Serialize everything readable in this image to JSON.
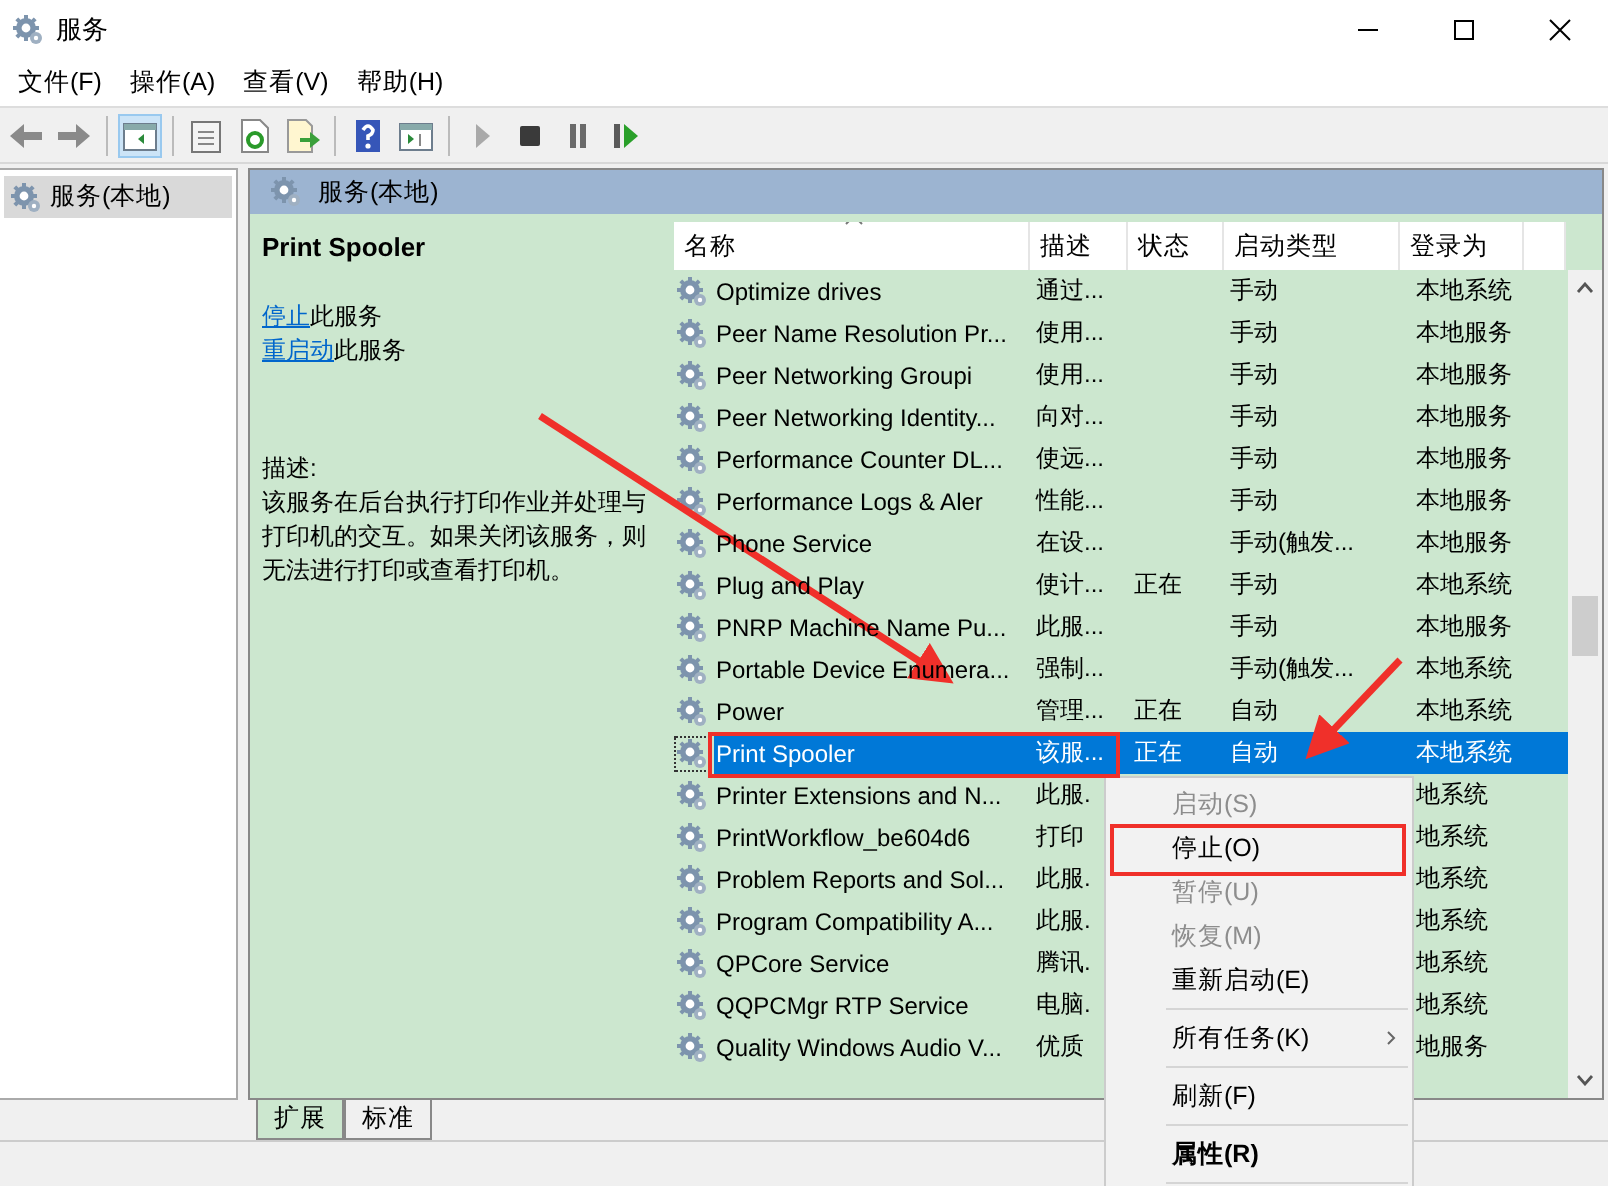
{
  "window": {
    "title": "服务"
  },
  "menu": [
    "文件(F)",
    "操作(A)",
    "查看(V)",
    "帮助(H)"
  ],
  "toolbar": [
    {
      "kind": "back",
      "disabled": false,
      "selected": false
    },
    {
      "kind": "forward",
      "disabled": false,
      "selected": false
    },
    {
      "kind": "separator"
    },
    {
      "kind": "tree",
      "disabled": false,
      "selected": true
    },
    {
      "kind": "separator"
    },
    {
      "kind": "properties",
      "disabled": false,
      "selected": false
    },
    {
      "kind": "refresh",
      "disabled": false,
      "selected": false
    },
    {
      "kind": "export",
      "disabled": false,
      "selected": false
    },
    {
      "kind": "separator"
    },
    {
      "kind": "help",
      "disabled": false,
      "selected": false
    },
    {
      "kind": "pane",
      "disabled": false,
      "selected": false
    },
    {
      "kind": "separator"
    },
    {
      "kind": "play",
      "disabled": true,
      "selected": false
    },
    {
      "kind": "stop",
      "disabled": false,
      "selected": false
    },
    {
      "kind": "pause",
      "disabled": false,
      "selected": false
    },
    {
      "kind": "resume",
      "disabled": false,
      "selected": false
    }
  ],
  "tree": {
    "items": [
      {
        "label": "服务(本地)",
        "selected": true
      }
    ]
  },
  "pane": {
    "title": "服务(本地)"
  },
  "details": {
    "title": "Print Spooler",
    "actions": [
      {
        "link": "停止",
        "text": "此服务"
      },
      {
        "link": "重启动",
        "text": "此服务"
      }
    ],
    "description_label": "描述:",
    "description": "该服务在后台执行打印作业并处理与打印机的交互。如果关闭该服务，则无法进行打印或查看打印机。"
  },
  "table": {
    "columns": [
      "名称",
      "描述",
      "状态",
      "启动类型",
      "登录为"
    ],
    "rows": [
      {
        "name": "Optimize drives",
        "desc": "通过...",
        "startup": "手动",
        "login": "本地系统",
        "selected": false
      },
      {
        "name": "Peer Name Resolution Pr...",
        "desc": "使用...",
        "startup": "手动",
        "login": "本地服务",
        "selected": false
      },
      {
        "name": "Peer Networking Groupi",
        "desc": "使用...",
        "startup": "手动",
        "login": "本地服务",
        "selected": false
      },
      {
        "name": "Peer Networking Identity...",
        "desc": "向对...",
        "startup": "手动",
        "login": "本地服务",
        "selected": false
      },
      {
        "name": "Performance Counter DL...",
        "desc": "使远...",
        "startup": "手动",
        "login": "本地服务",
        "selected": false
      },
      {
        "name": "Performance Logs & Aler",
        "desc": "性能...",
        "startup": "手动",
        "login": "本地服务",
        "selected": false
      },
      {
        "name": "Phone Service",
        "desc": "在设...",
        "startup": "手动(触发...",
        "login": "本地服务",
        "selected": false
      },
      {
        "name": "Plug and Play",
        "desc": "使计...",
        "status": "正在",
        "startup": "手动",
        "login": "本地系统",
        "selected": false
      },
      {
        "name": "PNRP Machine Name Pu...",
        "desc": "此服...",
        "startup": "手动",
        "login": "本地服务",
        "selected": false
      },
      {
        "name": "Portable Device Enumera...",
        "desc": "强制...",
        "startup": "手动(触发...",
        "login": "本地系统",
        "selected": false
      },
      {
        "name": "Power",
        "desc": "管理...",
        "status": "正在",
        "startup": "自动",
        "login": "本地系统",
        "selected": false
      },
      {
        "name": "Print Spooler",
        "desc": "该服...",
        "status": "正在",
        "startup": "自动",
        "login": "本地系统",
        "selected": true
      },
      {
        "name": "Printer Extensions and N...",
        "desc": "此服.",
        "login": "地系统",
        "selected": false
      },
      {
        "name": "PrintWorkflow_be604d6",
        "desc": "打印",
        "login": "地系统",
        "selected": false
      },
      {
        "name": "Problem Reports and Sol...",
        "desc": "此服.",
        "login": "地系统",
        "selected": false
      },
      {
        "name": "Program Compatibility A...",
        "desc": "此服.",
        "login": "地系统",
        "selected": false
      },
      {
        "name": "QPCore Service",
        "desc": "腾讯.",
        "login": "地系统",
        "selected": false
      },
      {
        "name": "QQPCMgr RTP Service",
        "desc": "电脑.",
        "login": "地系统",
        "selected": false
      },
      {
        "name": "Quality Windows Audio V...",
        "desc": "优质",
        "login": "地服务",
        "selected": false
      }
    ]
  },
  "context_menu": [
    {
      "kind": "item",
      "label": "启动(S)",
      "disabled": true,
      "default": false,
      "submenu": false
    },
    {
      "kind": "item",
      "label": "停止(O)",
      "disabled": false,
      "default": false,
      "submenu": false
    },
    {
      "kind": "item",
      "label": "暂停(U)",
      "disabled": true,
      "default": false,
      "submenu": false
    },
    {
      "kind": "item",
      "label": "恢复(M)",
      "disabled": true,
      "default": false,
      "submenu": false
    },
    {
      "kind": "item",
      "label": "重新启动(E)",
      "disabled": false,
      "default": false,
      "submenu": false
    },
    {
      "kind": "separator"
    },
    {
      "kind": "item",
      "label": "所有任务(K)",
      "disabled": false,
      "default": false,
      "submenu": true
    },
    {
      "kind": "separator"
    },
    {
      "kind": "item",
      "label": "刷新(F)",
      "disabled": false,
      "default": false,
      "submenu": false
    },
    {
      "kind": "separator"
    },
    {
      "kind": "item",
      "label": "属性(R)",
      "disabled": false,
      "default": true,
      "submenu": false
    },
    {
      "kind": "separator"
    }
  ],
  "bottom_tabs": [
    {
      "label": "扩展",
      "selected": true
    },
    {
      "label": "标准",
      "selected": false
    }
  ]
}
